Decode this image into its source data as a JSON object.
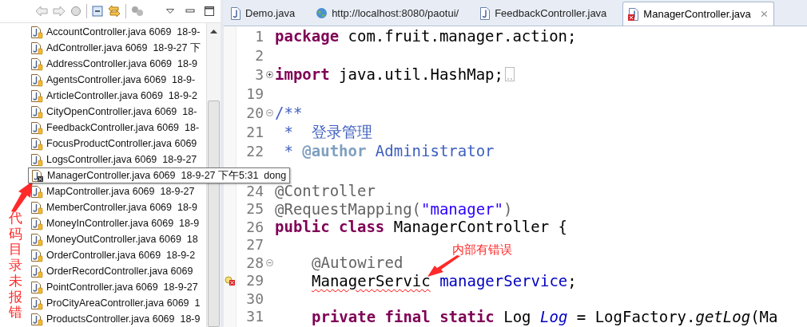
{
  "explorer": {
    "files": [
      {
        "label": "AccountController.java 6069  18-9-",
        "error": false,
        "hovered": false
      },
      {
        "label": "AdController.java 6069  18-9-27 下",
        "error": false,
        "hovered": false
      },
      {
        "label": "AddressController.java 6069  18-9",
        "error": false,
        "hovered": false
      },
      {
        "label": "AgentsController.java 6069  18-9-",
        "error": false,
        "hovered": false
      },
      {
        "label": "ArticleController.java 6069  18-9-2",
        "error": false,
        "hovered": false
      },
      {
        "label": "CityOpenController.java 6069  18-",
        "error": false,
        "hovered": false
      },
      {
        "label": "FeedbackController.java 6069  18-",
        "error": false,
        "hovered": false
      },
      {
        "label": "FocusProductController.java 6069",
        "error": false,
        "hovered": false
      },
      {
        "label": "LogsController.java 6069  18-9-27",
        "error": false,
        "hovered": false
      },
      {
        "label": "ManagerController.java 6069  18-9-27 下午5:31  dong",
        "error": true,
        "hovered": true
      },
      {
        "label": "MapController.java 6069  18-9-27",
        "error": false,
        "hovered": false
      },
      {
        "label": "MemberController.java 6069  18-9",
        "error": false,
        "hovered": false
      },
      {
        "label": "MoneyInController.java 6069  18-9",
        "error": false,
        "hovered": false
      },
      {
        "label": "MoneyOutController.java 6069  18",
        "error": false,
        "hovered": false
      },
      {
        "label": "OrderController.java 6069  18-9-2",
        "error": false,
        "hovered": false
      },
      {
        "label": "OrderRecordController.java 6069",
        "error": false,
        "hovered": false
      },
      {
        "label": "PointController.java 6069  18-9-27",
        "error": false,
        "hovered": false
      },
      {
        "label": "ProCityAreaController.java 6069  1",
        "error": false,
        "hovered": false
      },
      {
        "label": "ProductsController.java 6069  18-9",
        "error": false,
        "hovered": false
      }
    ]
  },
  "editor": {
    "tabs": [
      {
        "label": "Demo.java",
        "kind": "java",
        "selected": false,
        "error": false
      },
      {
        "label": "http://localhost:8080/paotui/",
        "kind": "web",
        "selected": false,
        "error": false
      },
      {
        "label": "FeedbackController.java",
        "kind": "java",
        "selected": false,
        "error": false
      },
      {
        "label": "ManagerController.java",
        "kind": "java",
        "selected": true,
        "error": true,
        "close": "⨯"
      }
    ],
    "lines": [
      {
        "number": "1",
        "segments": [
          {
            "text": "package",
            "kind": "keyword"
          },
          {
            "text": " com.fruit.manager.action;",
            "kind": "plain"
          }
        ]
      },
      {
        "number": "2"
      },
      {
        "number": "3",
        "folded": true,
        "segments": [
          {
            "text": "import",
            "kind": "keyword"
          },
          {
            "text": " java.util.HashMap;",
            "kind": "plain"
          }
        ]
      },
      {
        "number": "19"
      },
      {
        "number": "20",
        "foldable": true,
        "segments": [
          {
            "text": "/**",
            "kind": "doc"
          }
        ]
      },
      {
        "number": "21",
        "segments": [
          {
            "text": " *  登录管理",
            "kind": "doc"
          }
        ]
      },
      {
        "number": "22",
        "segments": [
          {
            "text": " * ",
            "kind": "doc"
          },
          {
            "text": "@author",
            "kind": "doctag"
          },
          {
            "text": " Administrator",
            "kind": "doc"
          }
        ]
      },
      {
        "covered": true
      },
      {
        "number": "24",
        "segments": [
          {
            "text": "@Controller",
            "kind": "annotation"
          }
        ]
      },
      {
        "number": "25",
        "segments": [
          {
            "text": "@RequestMapping(",
            "kind": "annotation"
          },
          {
            "text": "\"manager\"",
            "kind": "string"
          },
          {
            "text": ")",
            "kind": "annotation"
          }
        ]
      },
      {
        "number": "26",
        "segments": [
          {
            "text": "public",
            "kind": "keyword"
          },
          {
            "text": " class",
            "kind": "keyword"
          },
          {
            "text": " ManagerController {",
            "kind": "plain"
          }
        ]
      },
      {
        "number": "27"
      },
      {
        "number": "28",
        "foldable": true,
        "indented": true,
        "segments": [
          {
            "text": "@Autowired",
            "kind": "annotation"
          }
        ]
      },
      {
        "number": "29",
        "error": true,
        "indented": true,
        "segments": [
          {
            "text": "ManagerServic",
            "kind": "error"
          },
          {
            "text": " managerService",
            "kind": "field"
          },
          {
            "text": ";",
            "kind": "plain"
          }
        ]
      },
      {
        "number": "30"
      },
      {
        "number": "31",
        "indented": true,
        "segments": [
          {
            "text": "private",
            "kind": "keyword"
          },
          {
            "text": " final",
            "kind": "keyword"
          },
          {
            "text": " static",
            "kind": "keyword"
          },
          {
            "text": " Log ",
            "kind": "plain"
          },
          {
            "text": "Log",
            "kind": "static-field"
          },
          {
            "text": " = LogFactory.",
            "kind": "plain"
          },
          {
            "text": "getLog",
            "kind": "static-method"
          },
          {
            "text": "(Ma",
            "kind": "plain"
          }
        ]
      }
    ]
  },
  "notes": [
    {
      "text": "代码目录未报错",
      "kind": "vertical"
    },
    {
      "text": "内部有错误",
      "kind": "horizontal"
    }
  ]
}
